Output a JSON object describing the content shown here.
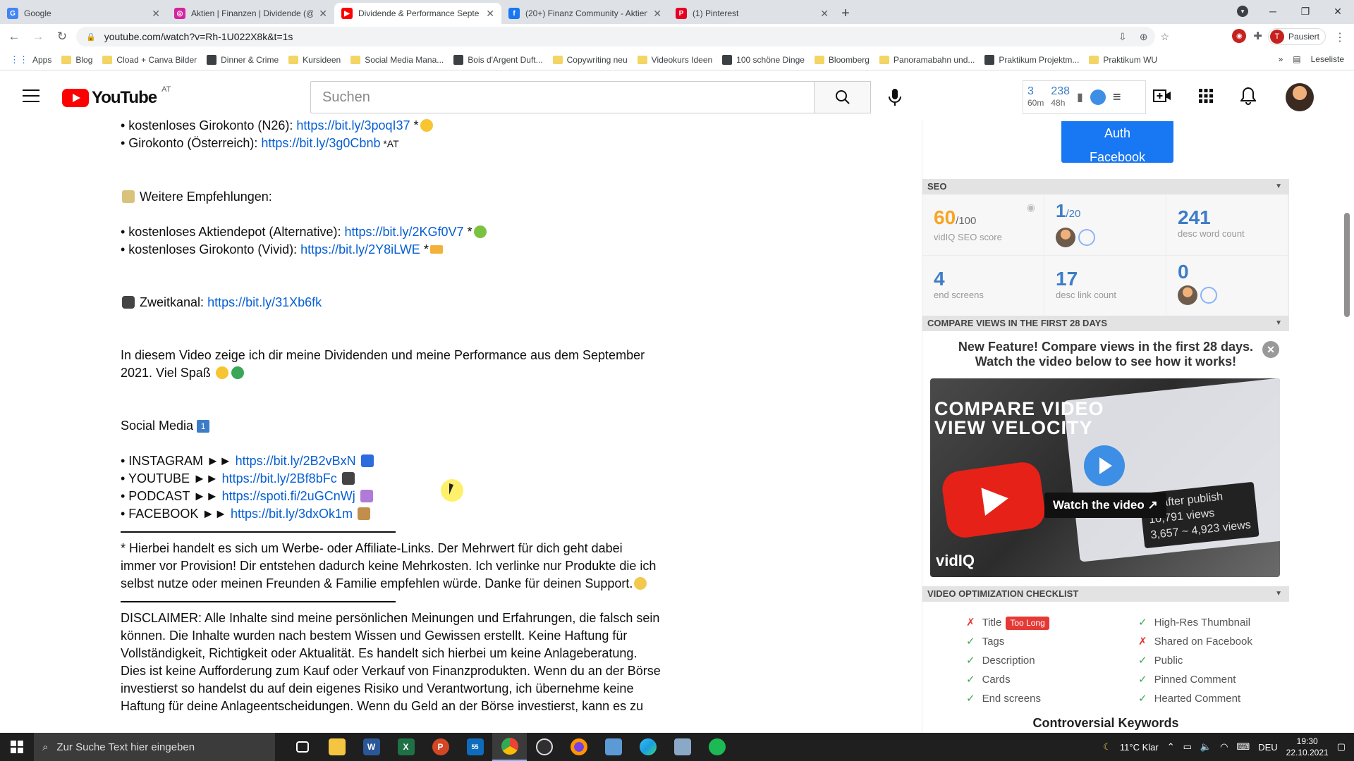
{
  "browser": {
    "tabs": [
      {
        "title": "Google",
        "fav": "G",
        "color": "#4285f4",
        "active": false
      },
      {
        "title": "Aktien | Finanzen | Dividende (@",
        "fav": "◎",
        "color": "#d6249f",
        "active": false
      },
      {
        "title": "Dividende & Performance Septe",
        "fav": "▶",
        "color": "#ff0000",
        "active": true
      },
      {
        "title": "(20+) Finanz Community - Aktien",
        "fav": "f",
        "color": "#1877f2",
        "active": false
      },
      {
        "title": "(1) Pinterest",
        "fav": "P",
        "color": "#e60023",
        "active": false
      }
    ],
    "url": "youtube.com/watch?v=Rh-1U022X8k&t=1s",
    "profile_label": "Pausiert",
    "profile_initial": "T",
    "bookmarks": [
      {
        "label": "Apps",
        "type": "apps"
      },
      {
        "label": "Blog",
        "type": "folder"
      },
      {
        "label": "Cload + Canva Bilder",
        "type": "folder"
      },
      {
        "label": "Dinner & Crime",
        "type": "site"
      },
      {
        "label": "Kursideen",
        "type": "folder"
      },
      {
        "label": "Social Media Mana...",
        "type": "folder"
      },
      {
        "label": "Bois d'Argent Duft...",
        "type": "site"
      },
      {
        "label": "Copywriting neu",
        "type": "folder"
      },
      {
        "label": "Videokurs Ideen",
        "type": "folder"
      },
      {
        "label": "100 schöne Dinge",
        "type": "site"
      },
      {
        "label": "Bloomberg",
        "type": "folder"
      },
      {
        "label": "Panoramabahn und...",
        "type": "folder"
      },
      {
        "label": "Praktikum Projektm...",
        "type": "site"
      },
      {
        "label": "Praktikum WU",
        "type": "folder"
      }
    ],
    "reading_list": "Leseliste"
  },
  "youtube": {
    "logo_text": "YouTube",
    "region": "AT",
    "search_placeholder": "Suchen",
    "vidiq": {
      "a_value": "3",
      "a_unit": "60m",
      "b_value": "238",
      "b_unit": "48h"
    }
  },
  "description": {
    "line_n26_prefix": "• kostenloses Girokonto (N26): ",
    "line_n26_link": "https://bit.ly/3poqI37",
    "line_n26_suffix": " *",
    "line_at_prefix": "• Girokonto (Österreich): ",
    "line_at_link": "https://bit.ly/3g0Cbnb",
    "line_at_suffix": " *AT",
    "weitere": "Weitere Empfehlungen:",
    "alt_prefix": "• kostenloses Aktiendepot (Alternative): ",
    "alt_link": "https://bit.ly/2KGf0V7",
    "alt_suffix": " *",
    "vivid_prefix": "• kostenloses Girokonto (Vivid): ",
    "vivid_link": "https://bit.ly/2Y8iLWE",
    "vivid_suffix": " *",
    "zweit_prefix": "Zweitkanal: ",
    "zweit_link": "https://bit.ly/31Xb6fk",
    "video_line1": "In diesem Video zeige ich dir meine Dividenden und meine Performance aus dem September",
    "video_line2": "2021. Viel Spaß",
    "social_title": "Social Media",
    "social_badge": "1",
    "socials": [
      {
        "prefix": "• INSTAGRAM ►► ",
        "link": "https://bit.ly/2B2vBxN"
      },
      {
        "prefix": "• YOUTUBE ►► ",
        "link": "https://bit.ly/2Bf8bFc"
      },
      {
        "prefix": "• PODCAST ►► ",
        "link": "https://spoti.fi/2uGCnWj"
      },
      {
        "prefix": "• FACEBOOK ►► ",
        "link": "https://bit.ly/3dxOk1m"
      }
    ],
    "affiliate": [
      "* Hierbei handelt es sich um Werbe- oder Affiliate-Links. Der Mehrwert für dich geht dabei",
      "immer vor Provision! Dir entstehen dadurch keine Mehrkosten. Ich verlinke nur Produkte die ich",
      "selbst nutze oder meinen Freunden & Familie empfehlen würde. Danke für deinen Support."
    ],
    "disclaimer": [
      "DISCLAIMER: Alle Inhalte sind meine persönlichen Meinungen und Erfahrungen, die falsch sein",
      "können. Die Inhalte wurden nach bestem Wissen und Gewissen erstellt. Keine Haftung für",
      "Vollständigkeit, Richtigkeit oder Aktualität. Es handelt sich hierbei um keine Anlageberatung.",
      "Dies ist keine Aufforderung zum Kauf oder Verkauf von Finanzprodukten. Wenn du an der Börse",
      "investierst so handelst du auf dein eigenes Risiko und Verantwortung, ich übernehme keine",
      "Haftung für deine Anlageentscheidungen. Wenn du Geld an der Börse investierst, kann es zu"
    ]
  },
  "panel": {
    "auth_line1": "Auth",
    "auth_line2": "Facebook",
    "seo_title": "SEO",
    "seo_score": "60",
    "seo_score_max": "/100",
    "seo_score_label": "vidIQ SEO score",
    "rank": "1",
    "rank_max": "/20",
    "word_count": "241",
    "word_count_label": "desc word count",
    "end_screens": "4",
    "end_screens_label": "end screens",
    "link_count": "17",
    "link_count_label": "desc link count",
    "zero": "0",
    "compare_title": "Compare views in the first 28 days",
    "compare_line1": "New Feature! Compare views in the first 28 days.",
    "compare_line2": "Watch the video below to see how it works!",
    "thumb_line1": "COMPARE VIDEO",
    "thumb_line2": "VIEW VELOCITY",
    "thumb_watch": "Watch the video",
    "thumb_stat1": "ys after publish",
    "thumb_stat2": "10,791 views",
    "thumb_stat3": "3,657 ~ 4,923 views",
    "thumb_brand": "vidIQ",
    "checklist_title": "Video Optimization Checklist",
    "checklist_left": [
      {
        "label": "Title",
        "ok": false,
        "badge": "Too Long"
      },
      {
        "label": "Tags",
        "ok": true,
        "badge": ""
      },
      {
        "label": "Description",
        "ok": true,
        "badge": ""
      },
      {
        "label": "Cards",
        "ok": true,
        "badge": ""
      },
      {
        "label": "End screens",
        "ok": true,
        "badge": ""
      }
    ],
    "checklist_right": [
      {
        "label": "High-Res Thumbnail",
        "ok": true
      },
      {
        "label": "Shared on Facebook",
        "ok": false
      },
      {
        "label": "Public",
        "ok": true
      },
      {
        "label": "Pinned Comment",
        "ok": true
      },
      {
        "label": "Hearted Comment",
        "ok": true
      }
    ],
    "controversial": "Controversial Keywords"
  },
  "taskbar": {
    "search_placeholder": "Zur Suche Text hier eingeben",
    "weather": "11°C  Klar",
    "lang": "DEU",
    "time": "19:30",
    "date": "22.10.2021",
    "mail_count": "55"
  }
}
